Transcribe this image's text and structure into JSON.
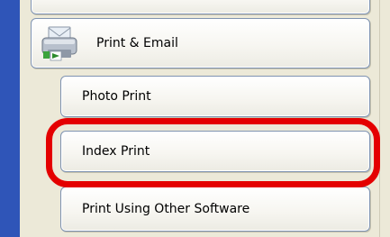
{
  "menu": {
    "category": {
      "label": "Print & Email",
      "icon": "printer-email-icon"
    },
    "items": [
      {
        "label": "Photo Print"
      },
      {
        "label": "Index Print",
        "highlighted": true
      },
      {
        "label": "Print Using Other Software"
      }
    ]
  },
  "colors": {
    "highlight": "#e40000",
    "pane": "#ece9d8",
    "strip": "#2f55b8",
    "button_border": "#7f93b1"
  }
}
